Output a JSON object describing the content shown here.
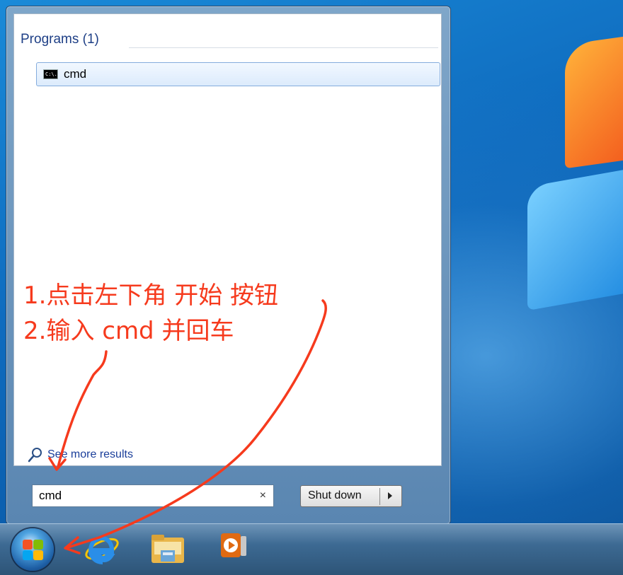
{
  "start_menu": {
    "section_header": "Programs (1)",
    "results": [
      {
        "label": "cmd",
        "icon": "command-prompt-icon",
        "icon_text": "C:\\."
      }
    ],
    "see_more": "See more results",
    "search": {
      "value": "cmd",
      "clear_symbol": "×"
    },
    "shutdown": {
      "label": "Shut down"
    }
  },
  "taskbar": {
    "pinned": [
      "start-button",
      "internet-explorer",
      "windows-explorer",
      "windows-media-player"
    ]
  },
  "annotations": {
    "line1": "1.点击左下角 开始 按钮",
    "line2": "2.输入 cmd 并回车",
    "color": "#f63a1d"
  },
  "colors": {
    "header_blue": "#1e3f86",
    "link_blue": "#1a3e9a",
    "selection_border": "#84acdd"
  }
}
